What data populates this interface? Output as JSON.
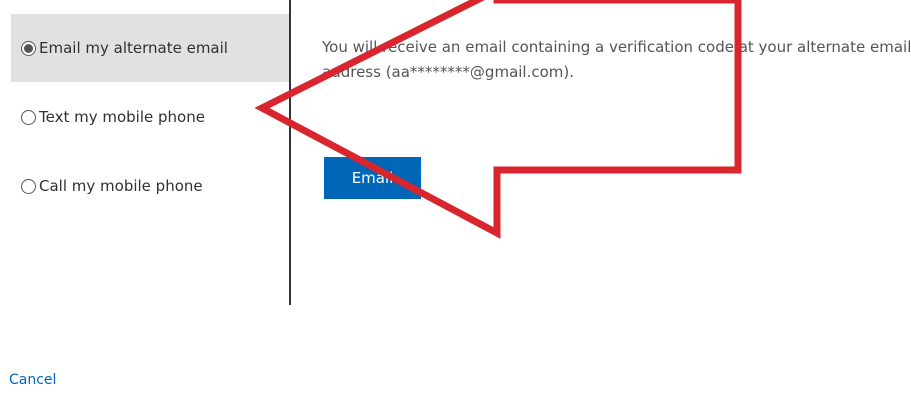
{
  "options": [
    {
      "label": "Email my alternate email",
      "selected": true
    },
    {
      "label": "Text my mobile phone",
      "selected": false
    },
    {
      "label": "Call my mobile phone",
      "selected": false
    }
  ],
  "description": "You will receive an email containing a verification code at your alternate email address (aa********@gmail.com).",
  "email_button_label": "Email",
  "cancel_label": "Cancel",
  "annotation": {
    "type": "arrow",
    "color": "#d9262e"
  }
}
